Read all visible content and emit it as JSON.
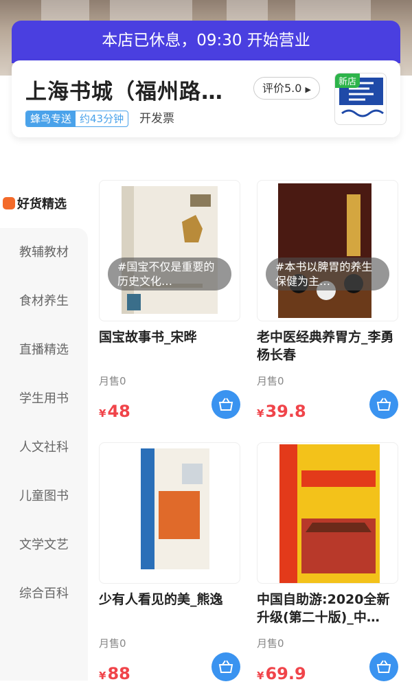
{
  "banner": {
    "text": "本店已休息，09:30 开始营业"
  },
  "shop": {
    "name": "上海书城（福州路…",
    "rating": "评价5.0",
    "delivery_tag": "蜂鸟专送",
    "delivery_time": "约43分钟",
    "invoice": "开发票",
    "new_badge": "新店"
  },
  "sidebar": {
    "active": "好货精选",
    "items": [
      {
        "label": "教辅教材"
      },
      {
        "label": "食材养生"
      },
      {
        "label": "直播精选"
      },
      {
        "label": "学生用书"
      },
      {
        "label": "人文社科"
      },
      {
        "label": "儿童图书"
      },
      {
        "label": "文学文艺"
      },
      {
        "label": "综合百科"
      }
    ]
  },
  "products": [
    {
      "title": "国宝故事书_宋晔",
      "sold": "月售0",
      "currency": "¥",
      "price": "48",
      "overlay": "#国宝不仅是重要的历史文化…"
    },
    {
      "title": "老中医经典养胃方_李勇 杨长春",
      "sold": "月售0",
      "currency": "¥",
      "price": "39.8",
      "overlay": "#本书以脾胃的养生保健为主…"
    },
    {
      "title": "少有人看见的美_熊逸",
      "sold": "月售0",
      "currency": "¥",
      "price": "88"
    },
    {
      "title": "中国自助游:2020全新升级(第二十版)_中…",
      "sold": "月售0",
      "currency": "¥",
      "price": "69.9"
    }
  ],
  "colors": {
    "banner": "#4a3fe0",
    "price": "#f0444a",
    "cart": "#3a93f0",
    "tag": "#4aa2ea"
  }
}
